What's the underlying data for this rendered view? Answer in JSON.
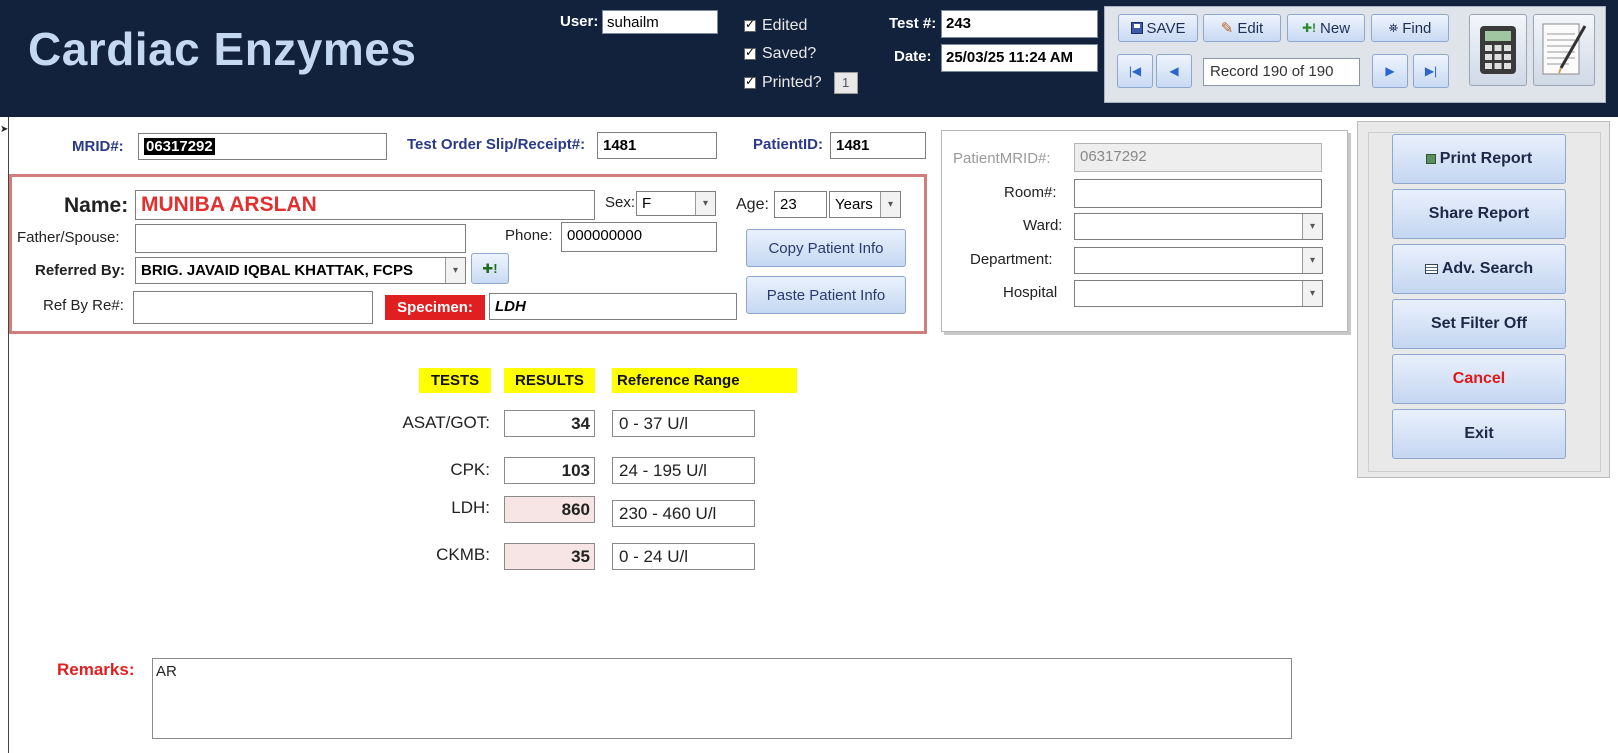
{
  "form_title": "Cardiac Enzymes",
  "header": {
    "user_label": "User:",
    "user_value": "suhailm",
    "edited_label": "Edited",
    "saved_label": "Saved?",
    "printed_label": "Printed?",
    "printed_count": "1",
    "test_no_label": "Test #:",
    "test_no_value": "243",
    "date_label": "Date:",
    "date_value": "25/03/25 11:24 AM"
  },
  "toolbar": {
    "save": "SAVE",
    "edit": "Edit",
    "new": "New",
    "find": "Find",
    "record_text": "Record 190 of 190"
  },
  "patient": {
    "mrid_label": "MRID#:",
    "mrid_value": "06317292",
    "receipt_label": "Test Order Slip/Receipt#:",
    "receipt_value": "1481",
    "patient_id_label": "PatientID:",
    "patient_id_value": "1481",
    "name_label": "Name:",
    "name_value": "MUNIBA ARSLAN",
    "sex_label": "Sex:",
    "sex_value": "F",
    "age_label": "Age:",
    "age_value": "23",
    "age_unit": "Years",
    "father_label": "Father/Spouse:",
    "father_value": "",
    "phone_label": "Phone:",
    "phone_value": "000000000",
    "referred_label": "Referred By:",
    "referred_value": "BRIG. JAVAID IQBAL KHATTAK, FCPS",
    "ref_by_re_label": "Ref By Re#:",
    "ref_by_re_value": "",
    "specimen_label": "Specimen:",
    "specimen_value": "LDH",
    "copy_btn": "Copy Patient Info",
    "paste_btn": "Paste Patient Info"
  },
  "location": {
    "patient_mrid_label": "PatientMRID#:",
    "patient_mrid_value": "06317292",
    "room_label": "Room#:",
    "ward_label": "Ward:",
    "department_label": "Department:",
    "hospital_label": "Hospital"
  },
  "actions": {
    "print": "Print Report",
    "share": "Share Report",
    "adv_search": "Adv. Search",
    "filter": "Set Filter Off",
    "cancel": "Cancel",
    "exit": "Exit"
  },
  "results": {
    "col_tests": "TESTS",
    "col_results": "RESULTS",
    "col_ref": "Reference Range",
    "rows": [
      {
        "test": "ASAT/GOT:",
        "result": "34",
        "ref": "0 - 37 U/l"
      },
      {
        "test": "CPK:",
        "result": "103",
        "ref": "24 - 195 U/l"
      },
      {
        "test": "LDH:",
        "result": "860",
        "ref": "230 - 460 U/l"
      },
      {
        "test": "CKMB:",
        "result": "35",
        "ref": "0 - 24 U/l"
      }
    ]
  },
  "remarks": {
    "label": "Remarks:",
    "value": "AR"
  },
  "colors": {
    "header_bg": "#12223d",
    "title": "#c5d8f2",
    "patient_name": "#e03030",
    "specimen_bg": "#e02020",
    "highlight_result": "#f7e4e4",
    "column_header": "#ffff00"
  }
}
